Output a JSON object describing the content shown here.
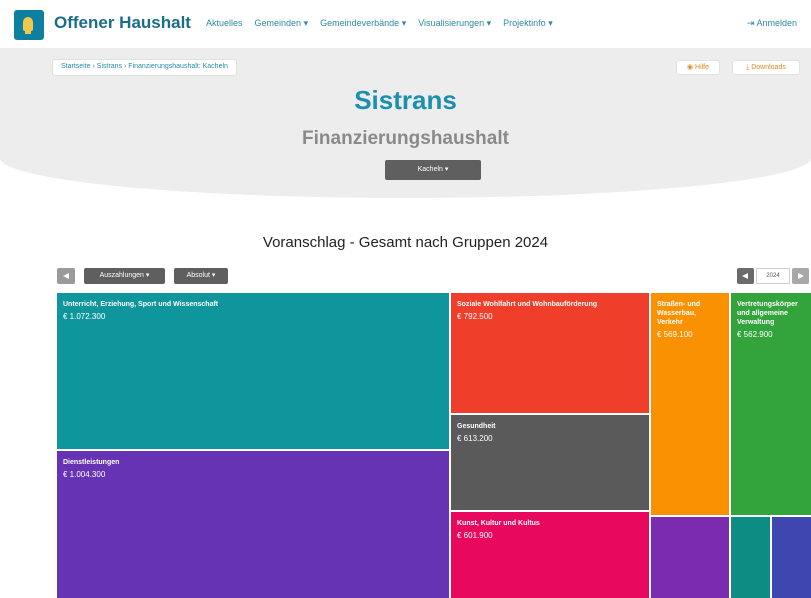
{
  "nav": {
    "brand": "Offener Haushalt",
    "menu": [
      "Aktuelles",
      "Gemeinden",
      "Gemeindeverbände",
      "Visualisierungen",
      "Projektinfo"
    ],
    "login": "Anmelden",
    "icons": {
      "logo": "lightbulb-logo-icon",
      "login": "sign-in-icon",
      "dropdown": "caret-down-icon"
    }
  },
  "breadcrumb": "Startseite › Sistrans › Finanzierungshaushalt: Kacheln",
  "header": {
    "help_label": "Hilfe",
    "downloads_label": "Downloads",
    "title": "Sistrans",
    "subtitle": "Finanzierungshaushalt",
    "view_select": "Kacheln"
  },
  "chart_title": "Voranschlag - Gesamt nach Gruppen 2024",
  "controls": {
    "type_dropdown": "Auszahlungen",
    "mode_dropdown": "Absolut",
    "year": "2024"
  },
  "colors": {
    "brand": "#1a6e8a",
    "accent": "#1c8fb0",
    "teal": "#0f969d",
    "purple": "#6733b5",
    "red": "#ef3e2a",
    "gray": "#5a5a5a",
    "magenta": "#e8095e",
    "orange": "#fa9102",
    "green": "#33a43c"
  },
  "chart_data": {
    "type": "treemap",
    "unit": "€",
    "items": [
      {
        "label": "Unterricht, Erziehung, Sport und Wissenschaft",
        "value": 1072300,
        "display": "€ 1.072.300",
        "color": "#0f969d"
      },
      {
        "label": "Dienstleistungen",
        "value": 1004300,
        "display": "€ 1.004.300",
        "color": "#6733b5"
      },
      {
        "label": "Soziale Wohlfahrt und Wohnbauförderung",
        "value": 792500,
        "display": "€ 792.500",
        "color": "#ef3e2a"
      },
      {
        "label": "Gesundheit",
        "value": 613200,
        "display": "€ 613.200",
        "color": "#5a5a5a"
      },
      {
        "label": "Kunst, Kultur und Kultus",
        "value": 601900,
        "display": "€ 601.900",
        "color": "#e8095e"
      },
      {
        "label": "Straßen- und Wasserbau, Verkehr",
        "value": 569100,
        "display": "€ 569.100",
        "color": "#fa9102"
      },
      {
        "label": "Vertretungskörper und allgemeine Verwaltung",
        "value": 562900,
        "display": "€ 562.900",
        "color": "#33a43c"
      },
      {
        "label": "",
        "display": "",
        "color": "#7a2bb0"
      },
      {
        "label": "",
        "display": "",
        "color": "#0d8c84"
      },
      {
        "label": "",
        "display": "",
        "color": "#3f46b0"
      }
    ]
  }
}
